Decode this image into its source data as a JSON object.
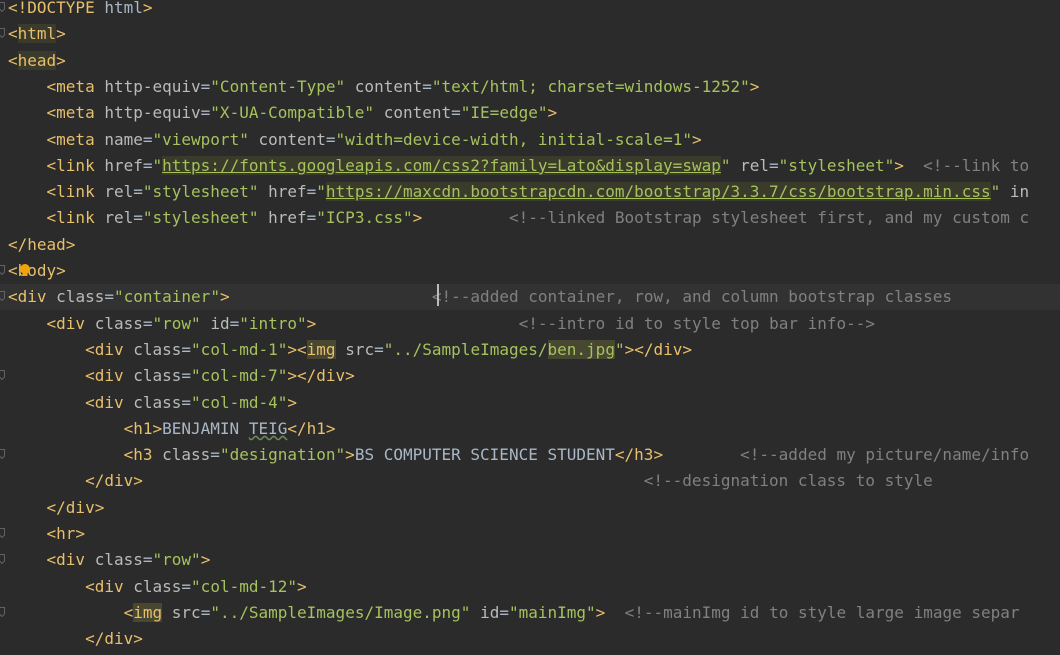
{
  "editor": {
    "language": "HTML",
    "caret_line": 12,
    "colors": {
      "background": "#2b2b2b",
      "current_line": "#323232",
      "tag": "#e8bf6a",
      "attribute": "#bababa",
      "string": "#a5c25c",
      "comment": "#808080",
      "text": "#a9b7c6"
    },
    "lines": [
      [
        [
          "tag",
          "<!DOCTYPE "
        ],
        [
          "txt",
          "html"
        ],
        [
          "tag",
          ">"
        ]
      ],
      [
        [
          "tag",
          "<"
        ],
        [
          "taghl",
          "html"
        ],
        [
          "tag",
          ">"
        ]
      ],
      [
        [
          "tag",
          "<"
        ],
        [
          "taghl",
          "head"
        ],
        [
          "tag",
          ">"
        ]
      ],
      [
        [
          "txt",
          "    "
        ],
        [
          "tag",
          "<meta "
        ],
        [
          "attr",
          "http-equiv"
        ],
        [
          "eq",
          "="
        ],
        [
          "str",
          "\"Content-Type\""
        ],
        [
          "txt",
          " "
        ],
        [
          "attr",
          "content"
        ],
        [
          "eq",
          "="
        ],
        [
          "str",
          "\"text/html; charset=windows-1252\""
        ],
        [
          "tag",
          ">"
        ]
      ],
      [
        [
          "txt",
          "    "
        ],
        [
          "tag",
          "<meta "
        ],
        [
          "attr",
          "http-equiv"
        ],
        [
          "eq",
          "="
        ],
        [
          "str",
          "\"X-UA-Compatible\""
        ],
        [
          "txt",
          " "
        ],
        [
          "attr",
          "content"
        ],
        [
          "eq",
          "="
        ],
        [
          "str",
          "\"IE=edge\""
        ],
        [
          "tag",
          ">"
        ]
      ],
      [
        [
          "txt",
          "    "
        ],
        [
          "tag",
          "<meta "
        ],
        [
          "attr",
          "name"
        ],
        [
          "eq",
          "="
        ],
        [
          "str",
          "\"viewport\""
        ],
        [
          "txt",
          " "
        ],
        [
          "attr",
          "content"
        ],
        [
          "eq",
          "="
        ],
        [
          "str",
          "\"width=device-width, initial-scale=1\""
        ],
        [
          "tag",
          ">"
        ]
      ],
      [
        [
          "txt",
          "    "
        ],
        [
          "tag",
          "<link "
        ],
        [
          "attr",
          "href"
        ],
        [
          "eq",
          "="
        ],
        [
          "str",
          "\""
        ],
        [
          "url",
          "https://fonts.googleapis.com/css2?family=Lato&display=swap"
        ],
        [
          "str",
          "\""
        ],
        [
          "txt",
          " "
        ],
        [
          "attr",
          "rel"
        ],
        [
          "eq",
          "="
        ],
        [
          "str",
          "\"stylesheet\""
        ],
        [
          "tag",
          ">"
        ],
        [
          "txt",
          "  "
        ],
        [
          "com",
          "<!--link to"
        ]
      ],
      [
        [
          "txt",
          "    "
        ],
        [
          "tag",
          "<link "
        ],
        [
          "attr",
          "rel"
        ],
        [
          "eq",
          "="
        ],
        [
          "str",
          "\"stylesheet\""
        ],
        [
          "txt",
          " "
        ],
        [
          "attr",
          "href"
        ],
        [
          "eq",
          "="
        ],
        [
          "str",
          "\""
        ],
        [
          "url",
          "https://maxcdn.bootstrapcdn.com/bootstrap/3.3.7/css/bootstrap.min.css"
        ],
        [
          "str",
          "\""
        ],
        [
          "txt",
          " "
        ],
        [
          "attr",
          "in"
        ]
      ],
      [
        [
          "txt",
          "    "
        ],
        [
          "tag",
          "<link "
        ],
        [
          "attr",
          "rel"
        ],
        [
          "eq",
          "="
        ],
        [
          "str",
          "\"stylesheet\""
        ],
        [
          "txt",
          " "
        ],
        [
          "attr",
          "href"
        ],
        [
          "eq",
          "="
        ],
        [
          "str",
          "\"ICP3.css\""
        ],
        [
          "tag",
          ">"
        ],
        [
          "txt",
          "         "
        ],
        [
          "com",
          "<!--linked Bootstrap stylesheet first, and my custom c"
        ]
      ],
      [
        [
          "tag",
          "</head>"
        ]
      ],
      [
        [
          "tag",
          "<"
        ],
        [
          "tag",
          "body>"
        ]
      ],
      [
        [
          "tag",
          "<div "
        ],
        [
          "attr",
          "class"
        ],
        [
          "eq",
          "="
        ],
        [
          "str",
          "\"container\""
        ],
        [
          "tag",
          ">"
        ],
        [
          "txt",
          "                     "
        ],
        [
          "com",
          "<!--added container, row, and column bootstrap classes"
        ]
      ],
      [
        [
          "txt",
          "    "
        ],
        [
          "tag",
          "<div "
        ],
        [
          "attr",
          "class"
        ],
        [
          "eq",
          "="
        ],
        [
          "str",
          "\"row\""
        ],
        [
          "txt",
          " "
        ],
        [
          "attr",
          "id"
        ],
        [
          "eq",
          "="
        ],
        [
          "str",
          "\"intro\""
        ],
        [
          "tag",
          ">"
        ],
        [
          "txt",
          "                     "
        ],
        [
          "com",
          "<!--intro id to style top bar info-->"
        ]
      ],
      [
        [
          "txt",
          "        "
        ],
        [
          "tag",
          "<div "
        ],
        [
          "attr",
          "class"
        ],
        [
          "eq",
          "="
        ],
        [
          "str",
          "\"col-md-1\""
        ],
        [
          "tag",
          ">"
        ],
        [
          "tag",
          "<"
        ],
        [
          "taghl2",
          "img"
        ],
        [
          "txt",
          " "
        ],
        [
          "attr",
          "src"
        ],
        [
          "eq",
          "="
        ],
        [
          "str",
          "\"../SampleImages/"
        ],
        [
          "strhl",
          "ben.jpg"
        ],
        [
          "str",
          "\""
        ],
        [
          "tag",
          ">"
        ],
        [
          "tag",
          "</div>"
        ]
      ],
      [
        [
          "txt",
          "        "
        ],
        [
          "tag",
          "<div "
        ],
        [
          "attr",
          "class"
        ],
        [
          "eq",
          "="
        ],
        [
          "str",
          "\"col-md-7\""
        ],
        [
          "tag",
          ">"
        ],
        [
          "tag",
          "</div>"
        ]
      ],
      [
        [
          "txt",
          "        "
        ],
        [
          "tag",
          "<div "
        ],
        [
          "attr",
          "class"
        ],
        [
          "eq",
          "="
        ],
        [
          "str",
          "\"col-md-4\""
        ],
        [
          "tag",
          ">"
        ]
      ],
      [
        [
          "txt",
          "            "
        ],
        [
          "tag",
          "<h1>"
        ],
        [
          "txt",
          "BENJAMIN "
        ],
        [
          "squiggle",
          "TEIG"
        ],
        [
          "tag",
          "</h1>"
        ]
      ],
      [
        [
          "txt",
          "            "
        ],
        [
          "tag",
          "<h3 "
        ],
        [
          "attr",
          "class"
        ],
        [
          "eq",
          "="
        ],
        [
          "str",
          "\"designation\""
        ],
        [
          "tag",
          ">"
        ],
        [
          "txt",
          "BS COMPUTER SCIENCE STUDENT"
        ],
        [
          "tag",
          "</h3>"
        ],
        [
          "txt",
          "        "
        ],
        [
          "com",
          "<!--added my picture/name/info"
        ]
      ],
      [
        [
          "txt",
          "        "
        ],
        [
          "tag",
          "</div>"
        ],
        [
          "txt",
          "                                                    "
        ],
        [
          "com",
          "<!--designation class to style"
        ]
      ],
      [
        [
          "txt",
          "    "
        ],
        [
          "tag",
          "</div>"
        ]
      ],
      [
        [
          "txt",
          "    "
        ],
        [
          "tag",
          "<hr>"
        ]
      ],
      [
        [
          "txt",
          "    "
        ],
        [
          "tag",
          "<div "
        ],
        [
          "attr",
          "class"
        ],
        [
          "eq",
          "="
        ],
        [
          "str",
          "\"row\""
        ],
        [
          "tag",
          ">"
        ]
      ],
      [
        [
          "txt",
          "        "
        ],
        [
          "tag",
          "<div "
        ],
        [
          "attr",
          "class"
        ],
        [
          "eq",
          "="
        ],
        [
          "str",
          "\"col-md-12\""
        ],
        [
          "tag",
          ">"
        ]
      ],
      [
        [
          "txt",
          "            "
        ],
        [
          "tag",
          "<"
        ],
        [
          "taghl2",
          "img"
        ],
        [
          "txt",
          " "
        ],
        [
          "attr",
          "src"
        ],
        [
          "eq",
          "="
        ],
        [
          "str",
          "\"../SampleImages/Image.png\""
        ],
        [
          "txt",
          " "
        ],
        [
          "attr",
          "id"
        ],
        [
          "eq",
          "="
        ],
        [
          "str",
          "\"mainImg\""
        ],
        [
          "tag",
          ">"
        ],
        [
          "txt",
          "  "
        ],
        [
          "com",
          "<!--mainImg id to style large image separ"
        ]
      ],
      [
        [
          "txt",
          "        "
        ],
        [
          "tag",
          "</div>"
        ]
      ]
    ],
    "fold_lines": [
      1,
      2,
      11,
      12,
      15,
      18,
      21,
      22,
      24
    ]
  }
}
